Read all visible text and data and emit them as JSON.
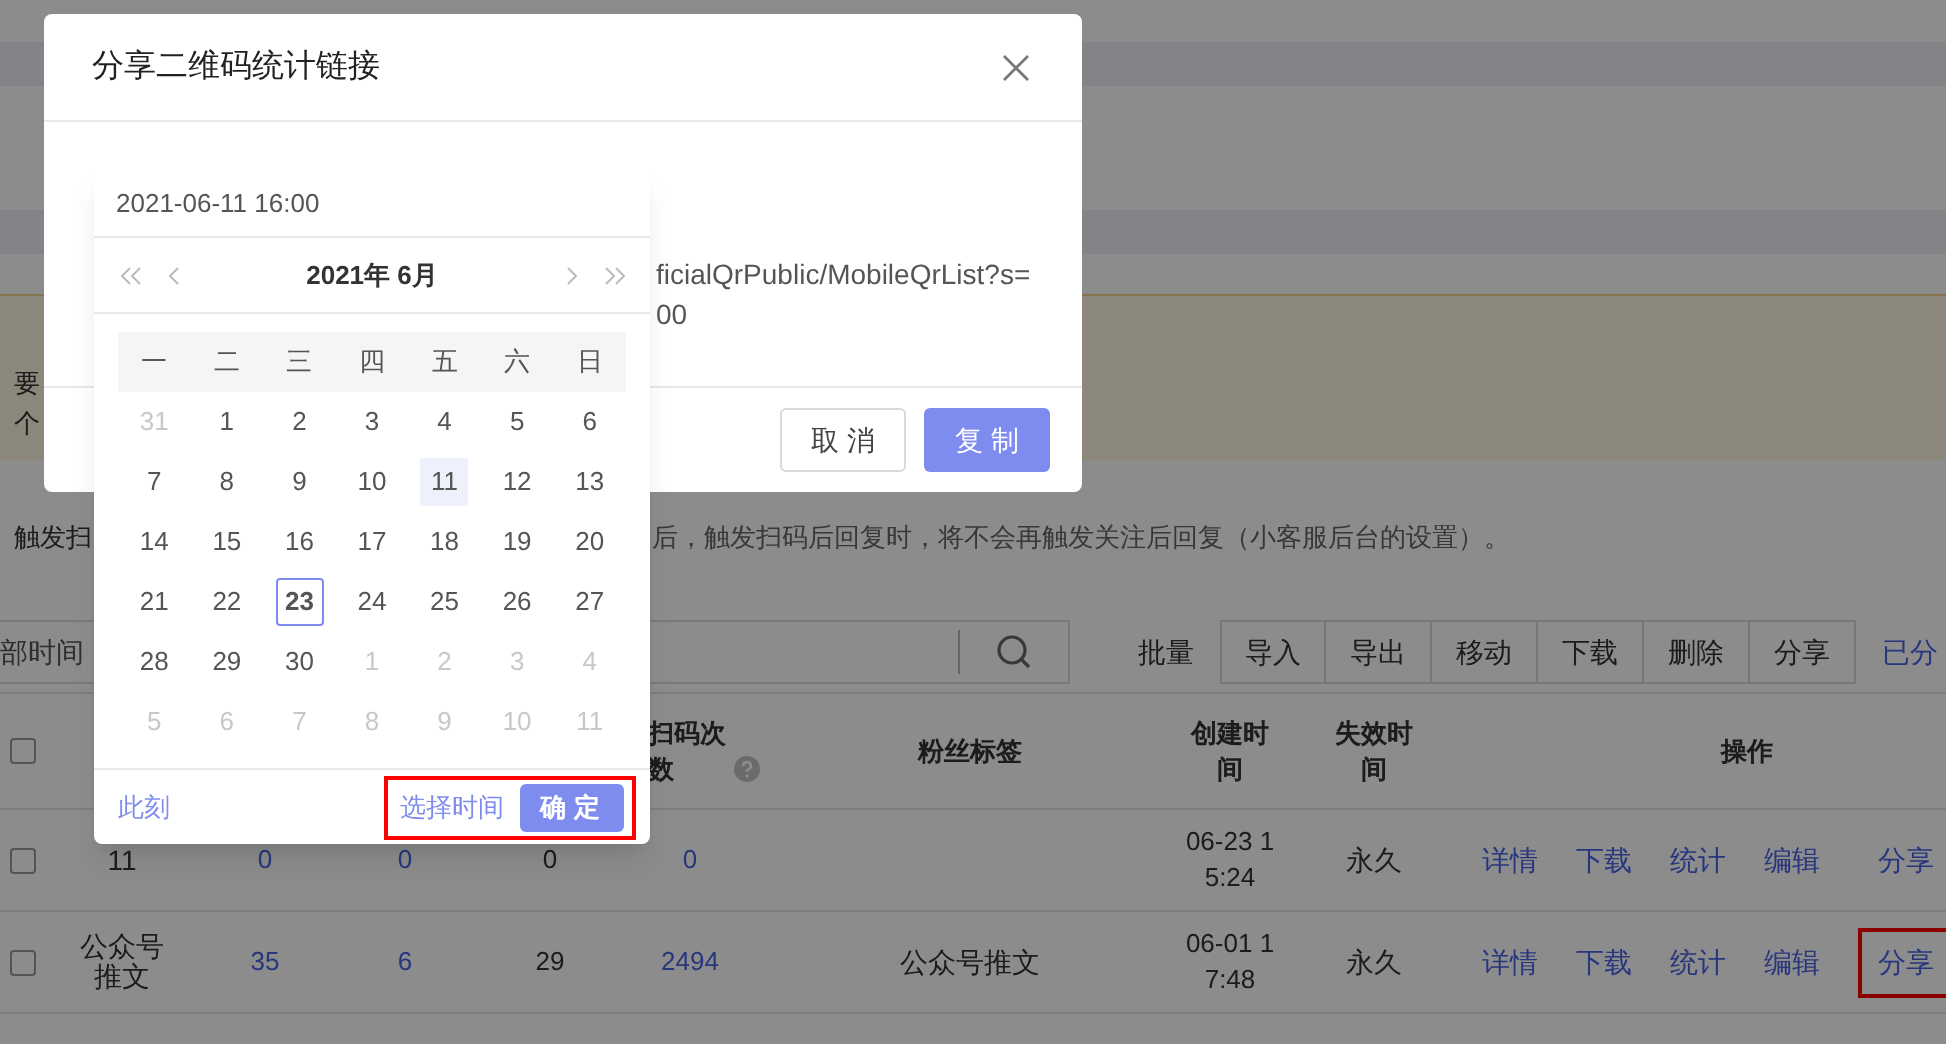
{
  "page": {
    "notice_lines": [
      "要",
      "个"
    ],
    "hint_parts": [
      "触发扫",
      "后，触发扫码后回复时，将不会再触发关注后回复（小客服后台的设置）。"
    ],
    "time_filter": "部时间",
    "batch_label": "批量",
    "batch_buttons": [
      "导入",
      "导出",
      "移动",
      "下载",
      "删除",
      "分享"
    ],
    "shared_link": "已分",
    "table": {
      "header_checked": false,
      "columns": {
        "scan_count": "扫码次数",
        "fan_tag": "粉丝标签",
        "created": "创建时间",
        "expires": "失效时间",
        "actions": "操作"
      },
      "rows": [
        {
          "checked": false,
          "column_2": "11",
          "column_3": "0",
          "column_4": "0",
          "column_5": "0",
          "scan_count": "0",
          "created": "06-23 15:24",
          "expires": "永久",
          "actions": [
            {
              "label": "详情",
              "highlighted": false
            },
            {
              "label": "下载",
              "highlighted": false
            },
            {
              "label": "统计",
              "highlighted": false
            },
            {
              "label": "编辑",
              "highlighted": false
            },
            {
              "label": "分享",
              "highlighted": false
            }
          ]
        },
        {
          "checked": false,
          "column_2": "公众号推文",
          "column_3": "35",
          "column_4": "6",
          "column_5": "29",
          "scan_count": "2494",
          "fan_tag": "公众号推文",
          "created": "06-01 17:48",
          "expires": "永久",
          "actions": [
            {
              "label": "详情",
              "highlighted": false
            },
            {
              "label": "下载",
              "highlighted": false
            },
            {
              "label": "统计",
              "highlighted": false
            },
            {
              "label": "编辑",
              "highlighted": false
            },
            {
              "label": "分享",
              "highlighted": true
            }
          ]
        }
      ]
    }
  },
  "modal": {
    "title": "分享二维码统计链接",
    "link_lines": [
      "ficialQrPublic/MobileQrList?s=",
      "00"
    ],
    "buttons": [
      {
        "label": "取消",
        "primary": false
      },
      {
        "label": "复制",
        "primary": true
      }
    ]
  },
  "date_picker": {
    "value": "2021-06-11 16:00",
    "month_label": "2021年 6月",
    "weekdays": [
      "一",
      "二",
      "三",
      "四",
      "五",
      "六",
      "日"
    ],
    "weeks": [
      [
        {
          "day": "31",
          "outside": true,
          "selected": false,
          "today": false
        },
        {
          "day": "1",
          "outside": false,
          "selected": false,
          "today": false
        },
        {
          "day": "2",
          "outside": false,
          "selected": false,
          "today": false
        },
        {
          "day": "3",
          "outside": false,
          "selected": false,
          "today": false
        },
        {
          "day": "4",
          "outside": false,
          "selected": false,
          "today": false
        },
        {
          "day": "5",
          "outside": false,
          "selected": false,
          "today": false
        },
        {
          "day": "6",
          "outside": false,
          "selected": false,
          "today": false
        }
      ],
      [
        {
          "day": "7",
          "outside": false,
          "selected": false,
          "today": false
        },
        {
          "day": "8",
          "outside": false,
          "selected": false,
          "today": false
        },
        {
          "day": "9",
          "outside": false,
          "selected": false,
          "today": false
        },
        {
          "day": "10",
          "outside": false,
          "selected": false,
          "today": false
        },
        {
          "day": "11",
          "outside": false,
          "selected": true,
          "today": false
        },
        {
          "day": "12",
          "outside": false,
          "selected": false,
          "today": false
        },
        {
          "day": "13",
          "outside": false,
          "selected": false,
          "today": false
        }
      ],
      [
        {
          "day": "14",
          "outside": false,
          "selected": false,
          "today": false
        },
        {
          "day": "15",
          "outside": false,
          "selected": false,
          "today": false
        },
        {
          "day": "16",
          "outside": false,
          "selected": false,
          "today": false
        },
        {
          "day": "17",
          "outside": false,
          "selected": false,
          "today": false
        },
        {
          "day": "18",
          "outside": false,
          "selected": false,
          "today": false
        },
        {
          "day": "19",
          "outside": false,
          "selected": false,
          "today": false
        },
        {
          "day": "20",
          "outside": false,
          "selected": false,
          "today": false
        }
      ],
      [
        {
          "day": "21",
          "outside": false,
          "selected": false,
          "today": false
        },
        {
          "day": "22",
          "outside": false,
          "selected": false,
          "today": false
        },
        {
          "day": "23",
          "outside": false,
          "selected": false,
          "today": true
        },
        {
          "day": "24",
          "outside": false,
          "selected": false,
          "today": false
        },
        {
          "day": "25",
          "outside": false,
          "selected": false,
          "today": false
        },
        {
          "day": "26",
          "outside": false,
          "selected": false,
          "today": false
        },
        {
          "day": "27",
          "outside": false,
          "selected": false,
          "today": false
        }
      ],
      [
        {
          "day": "28",
          "outside": false,
          "selected": false,
          "today": false
        },
        {
          "day": "29",
          "outside": false,
          "selected": false,
          "today": false
        },
        {
          "day": "30",
          "outside": false,
          "selected": false,
          "today": false
        },
        {
          "day": "1",
          "outside": true,
          "selected": false,
          "today": false
        },
        {
          "day": "2",
          "outside": true,
          "selected": false,
          "today": false
        },
        {
          "day": "3",
          "outside": true,
          "selected": false,
          "today": false
        },
        {
          "day": "4",
          "outside": true,
          "selected": false,
          "today": false
        }
      ],
      [
        {
          "day": "5",
          "outside": true,
          "selected": false,
          "today": false
        },
        {
          "day": "6",
          "outside": true,
          "selected": false,
          "today": false
        },
        {
          "day": "7",
          "outside": true,
          "selected": false,
          "today": false
        },
        {
          "day": "8",
          "outside": true,
          "selected": false,
          "today": false
        },
        {
          "day": "9",
          "outside": true,
          "selected": false,
          "today": false
        },
        {
          "day": "10",
          "outside": true,
          "selected": false,
          "today": false
        },
        {
          "day": "11",
          "outside": true,
          "selected": false,
          "today": false
        }
      ]
    ],
    "now_link": "此刻",
    "time_link": "选择时间",
    "confirm": "确定",
    "footer_highlighted": true
  }
}
